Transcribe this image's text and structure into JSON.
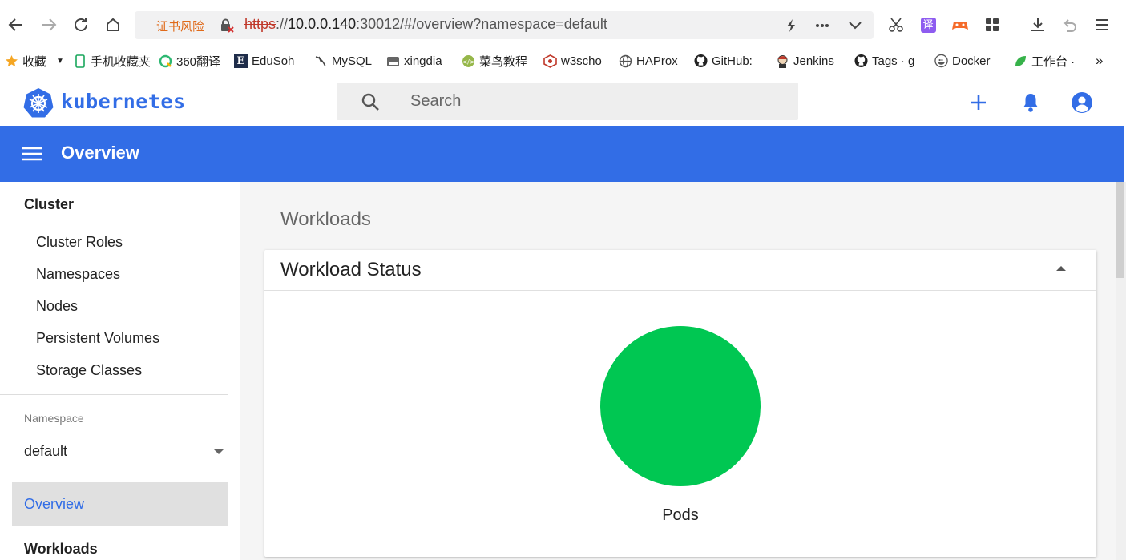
{
  "browser": {
    "cert_warning": "证书风险",
    "url_protocol": "https",
    "url_sep": "://",
    "url_host": "10.0.0.140",
    "url_rest": ":30012/#/overview?namespace=default",
    "translate_label": "译"
  },
  "bookmarks": [
    {
      "label": "收藏"
    },
    {
      "label": "手机收藏夹"
    },
    {
      "label": "360翻译"
    },
    {
      "label": "EduSoh"
    },
    {
      "label": "MySQL"
    },
    {
      "label": "xingdia"
    },
    {
      "label": "菜鸟教程"
    },
    {
      "label": "w3scho"
    },
    {
      "label": "HAProx"
    },
    {
      "label": "GitHub:"
    },
    {
      "label": "Jenkins"
    },
    {
      "label": "Tags · g"
    },
    {
      "label": "Docker"
    },
    {
      "label": "工作台 ·"
    }
  ],
  "app": {
    "brand": "kubernetes",
    "search_placeholder": "Search",
    "page_title": "Overview",
    "accent": "#326de6"
  },
  "sidebar": {
    "cluster_heading": "Cluster",
    "cluster_items": [
      "Cluster Roles",
      "Namespaces",
      "Nodes",
      "Persistent Volumes",
      "Storage Classes"
    ],
    "namespace_label": "Namespace",
    "namespace_value": "default",
    "overview": "Overview",
    "workloads": "Workloads"
  },
  "main": {
    "section_title": "Workloads",
    "card_title": "Workload Status",
    "pods_label": "Pods",
    "pods_color": "#00c752"
  }
}
